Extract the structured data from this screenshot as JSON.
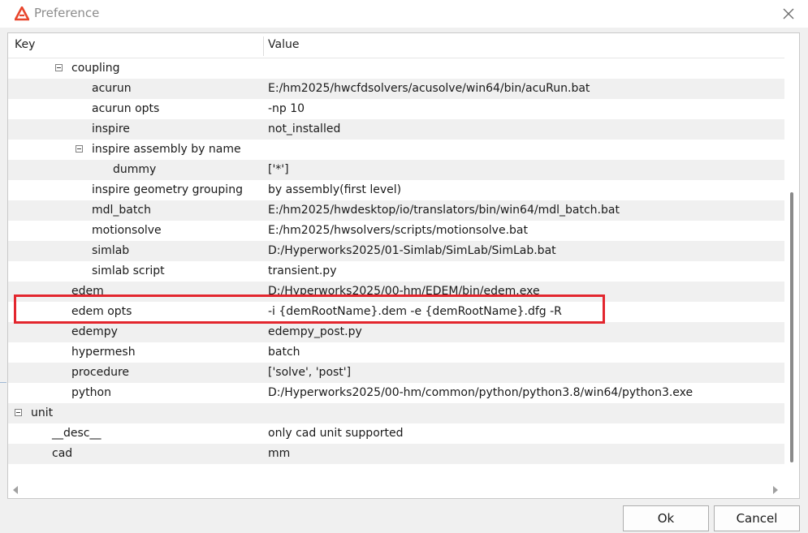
{
  "window": {
    "title": "Preference",
    "logo_icon": "altair-logo-icon",
    "close_icon": "close-icon"
  },
  "buttons": {
    "ok_label": "Ok",
    "cancel_label": "Cancel"
  },
  "table": {
    "header": {
      "key": "Key",
      "value": "Value"
    },
    "rows": [
      {
        "key": "coupling",
        "value": "",
        "level": 2,
        "expandable": true
      },
      {
        "key": "acurun",
        "value": "E:/hm2025/hwcfdsolvers/acusolve/win64/bin/acuRun.bat",
        "level": 3
      },
      {
        "key": "acurun opts",
        "value": "-np 10",
        "level": 3
      },
      {
        "key": "inspire",
        "value": "not_installed",
        "level": 3
      },
      {
        "key": "inspire assembly by name",
        "value": "",
        "level": 3,
        "expandable": true
      },
      {
        "key": "dummy",
        "value": "['*']",
        "level": 4
      },
      {
        "key": "inspire geometry grouping",
        "value": "by assembly(first level)",
        "level": 3
      },
      {
        "key": "mdl_batch",
        "value": "E:/hm2025/hwdesktop/io/translators/bin/win64/mdl_batch.bat",
        "level": 3
      },
      {
        "key": "motionsolve",
        "value": "E:/hm2025/hwsolvers/scripts/motionsolve.bat",
        "level": 3
      },
      {
        "key": "simlab",
        "value": "D:/Hyperworks2025/01-Simlab/SimLab/SimLab.bat",
        "level": 3
      },
      {
        "key": "simlab script",
        "value": "transient.py",
        "level": 3
      },
      {
        "key": "edem",
        "value": "D:/Hyperworks2025/00-hm/EDEM/bin/edem.exe",
        "level": 2
      },
      {
        "key": "edem opts",
        "value": "-i {demRootName}.dem -e {demRootName}.dfg -R",
        "level": 2,
        "highlighted": true
      },
      {
        "key": "edempy",
        "value": "edempy_post.py",
        "level": 2
      },
      {
        "key": "hypermesh",
        "value": "batch",
        "level": 2
      },
      {
        "key": "procedure",
        "value": "['solve', 'post']",
        "level": 2
      },
      {
        "key": "python",
        "value": "D:/Hyperworks2025/00-hm/common/python/python3.8/win64/python3.exe",
        "level": 2
      },
      {
        "key": "unit",
        "value": "",
        "level": 0,
        "expandable": true
      },
      {
        "key": "__desc__",
        "value": "only cad unit supported",
        "level": 1
      },
      {
        "key": "cad",
        "value": "mm",
        "level": 1
      }
    ]
  },
  "colors": {
    "highlight_border": "#e3262e",
    "logo": "#e8452c",
    "alt_row": "#f0f0f0"
  }
}
